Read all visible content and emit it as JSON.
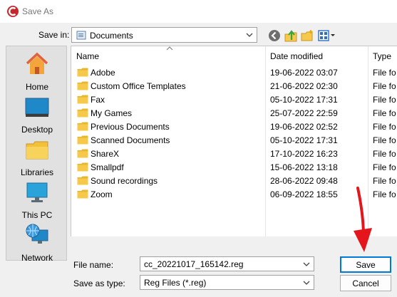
{
  "window": {
    "title": "Save As"
  },
  "toolbar": {
    "save_in_label": "Save in:",
    "save_in_value": "Documents"
  },
  "places": [
    {
      "label": "Home",
      "icon": "home-icon"
    },
    {
      "label": "Desktop",
      "icon": "desktop-icon"
    },
    {
      "label": "Libraries",
      "icon": "libraries-icon"
    },
    {
      "label": "This PC",
      "icon": "this-pc-icon"
    },
    {
      "label": "Network",
      "icon": "network-icon"
    }
  ],
  "file_list": {
    "columns": [
      "Name",
      "Date modified",
      "Type"
    ],
    "rows": [
      {
        "name": "Adobe",
        "date": "19-06-2022 03:07",
        "type": "File fo"
      },
      {
        "name": "Custom Office Templates",
        "date": "21-06-2022 02:30",
        "type": "File fo"
      },
      {
        "name": "Fax",
        "date": "05-10-2022 17:31",
        "type": "File fo"
      },
      {
        "name": "My Games",
        "date": "25-07-2022 22:59",
        "type": "File fo"
      },
      {
        "name": "Previous Documents",
        "date": "19-06-2022 02:52",
        "type": "File fo"
      },
      {
        "name": "Scanned Documents",
        "date": "05-10-2022 17:31",
        "type": "File fo"
      },
      {
        "name": "ShareX",
        "date": "17-10-2022 16:23",
        "type": "File fo"
      },
      {
        "name": "Smallpdf",
        "date": "15-06-2022 13:18",
        "type": "File fo"
      },
      {
        "name": "Sound recordings",
        "date": "28-06-2022 09:48",
        "type": "File fo"
      },
      {
        "name": "Zoom",
        "date": "06-09-2022 18:55",
        "type": "File fo"
      }
    ]
  },
  "bottom": {
    "file_name_label": "File name:",
    "file_name_value": "cc_20221017_165142.reg",
    "save_as_type_label": "Save as type:",
    "save_as_type_value": "Reg Files (*.reg)",
    "save_button": "Save",
    "cancel_button": "Cancel"
  },
  "colors": {
    "folder": "#f6c94a",
    "accent": "#0078d7",
    "annotation_arrow": "#e4161c"
  }
}
